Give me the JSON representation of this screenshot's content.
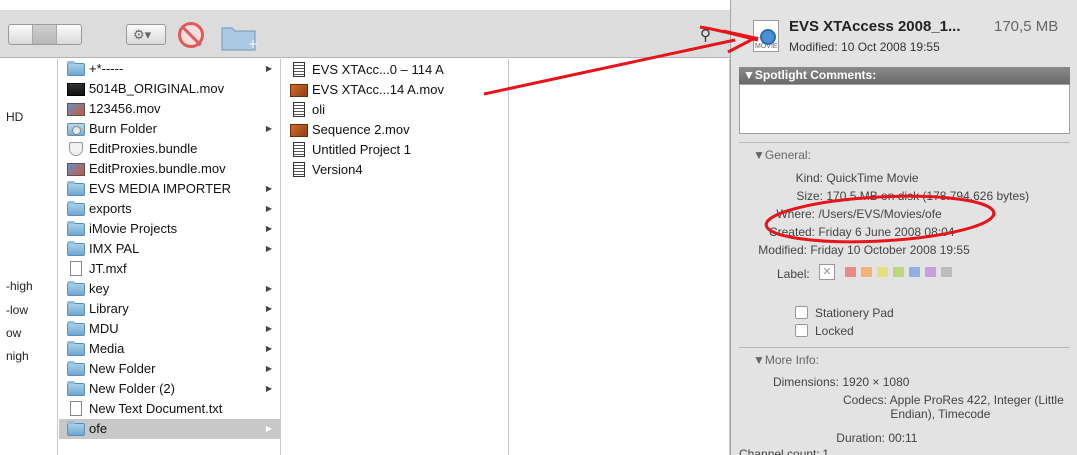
{
  "sidebar": {
    "items": [
      "HD",
      "-high",
      "-low",
      "ow",
      "nigh"
    ]
  },
  "column1": {
    "items": [
      {
        "label": "+*-----",
        "icon": "folder-icon",
        "arrow": true
      },
      {
        "label": "5014B_ORIGINAL.mov",
        "icon": "movie-icon",
        "arrow": false
      },
      {
        "label": "123456.mov",
        "icon": "movie-icon",
        "arrow": false
      },
      {
        "label": "Burn Folder",
        "icon": "burn-folder-icon",
        "arrow": true
      },
      {
        "label": "EditProxies.bundle",
        "icon": "bundle-icon",
        "arrow": false
      },
      {
        "label": "EditProxies.bundle.mov",
        "icon": "movie-icon",
        "arrow": false
      },
      {
        "label": "EVS MEDIA IMPORTER",
        "icon": "folder-icon",
        "arrow": true
      },
      {
        "label": "exports",
        "icon": "folder-icon",
        "arrow": true
      },
      {
        "label": "iMovie Projects",
        "icon": "folder-icon",
        "arrow": true
      },
      {
        "label": "IMX PAL",
        "icon": "folder-icon",
        "arrow": true
      },
      {
        "label": "JT.mxf",
        "icon": "document-icon",
        "arrow": false
      },
      {
        "label": "key",
        "icon": "folder-icon",
        "arrow": true
      },
      {
        "label": "Library",
        "icon": "folder-icon",
        "arrow": true
      },
      {
        "label": "MDU",
        "icon": "folder-icon",
        "arrow": true
      },
      {
        "label": "Media",
        "icon": "folder-icon",
        "arrow": true
      },
      {
        "label": "New Folder",
        "icon": "folder-icon",
        "arrow": true
      },
      {
        "label": "New Folder (2)",
        "icon": "folder-icon",
        "arrow": true
      },
      {
        "label": "New Text Document.txt",
        "icon": "document-icon",
        "arrow": false
      },
      {
        "label": "ofe",
        "icon": "folder-icon",
        "arrow": true,
        "selected": true
      }
    ]
  },
  "column2": {
    "items": [
      {
        "label": "EVS XTAcc...0 – 114 A",
        "icon": "project-icon"
      },
      {
        "label": "EVS XTAcc...14 A.mov",
        "icon": "movie-icon"
      },
      {
        "label": "oli",
        "icon": "project-icon"
      },
      {
        "label": "Sequence 2.mov",
        "icon": "movie-icon"
      },
      {
        "label": "Untitled Project 1",
        "icon": "project-icon"
      },
      {
        "label": "Version4",
        "icon": "project-icon"
      }
    ]
  },
  "info": {
    "title": "EVS XTAccess 2008_1...",
    "size": "170,5 MB",
    "modified": "Modified: 10 Oct 2008 19:55",
    "spotlight_label": "▼Spotlight Comments:",
    "general_label": "General:",
    "general": [
      {
        "key": "Kind:",
        "value": "QuickTime Movie"
      },
      {
        "key": "Size:",
        "value": "170,5 MB on disk (178.794.626 bytes)"
      },
      {
        "key": "Where:",
        "value": "/Users/EVS/Movies/ofe"
      },
      {
        "key": "Created:",
        "value": "Friday 6 June 2008 08:04"
      },
      {
        "key": "Modified:",
        "value": "Friday 10 October 2008 19:55"
      }
    ],
    "label_key": "Label:",
    "label_colors": [
      "#e88a8a",
      "#f0b27a",
      "#e9df7b",
      "#bcd67e",
      "#8fb3e0",
      "#c6a0d8",
      "#bdbdbd"
    ],
    "stationery_pad": "Stationery Pad",
    "locked": "Locked",
    "more_info_label": "More Info:",
    "more_info": [
      {
        "key": "Dimensions:",
        "value": "1920 × 1080"
      },
      {
        "key": "Codecs:",
        "value": "Apple ProRes 422, Integer (Little"
      },
      {
        "key": "",
        "value": "Endian), Timecode"
      },
      {
        "key": "Duration:",
        "value": "00:11"
      },
      {
        "key": "Channel count:",
        "value": "1"
      }
    ]
  },
  "annotation_color": "#e8141b"
}
